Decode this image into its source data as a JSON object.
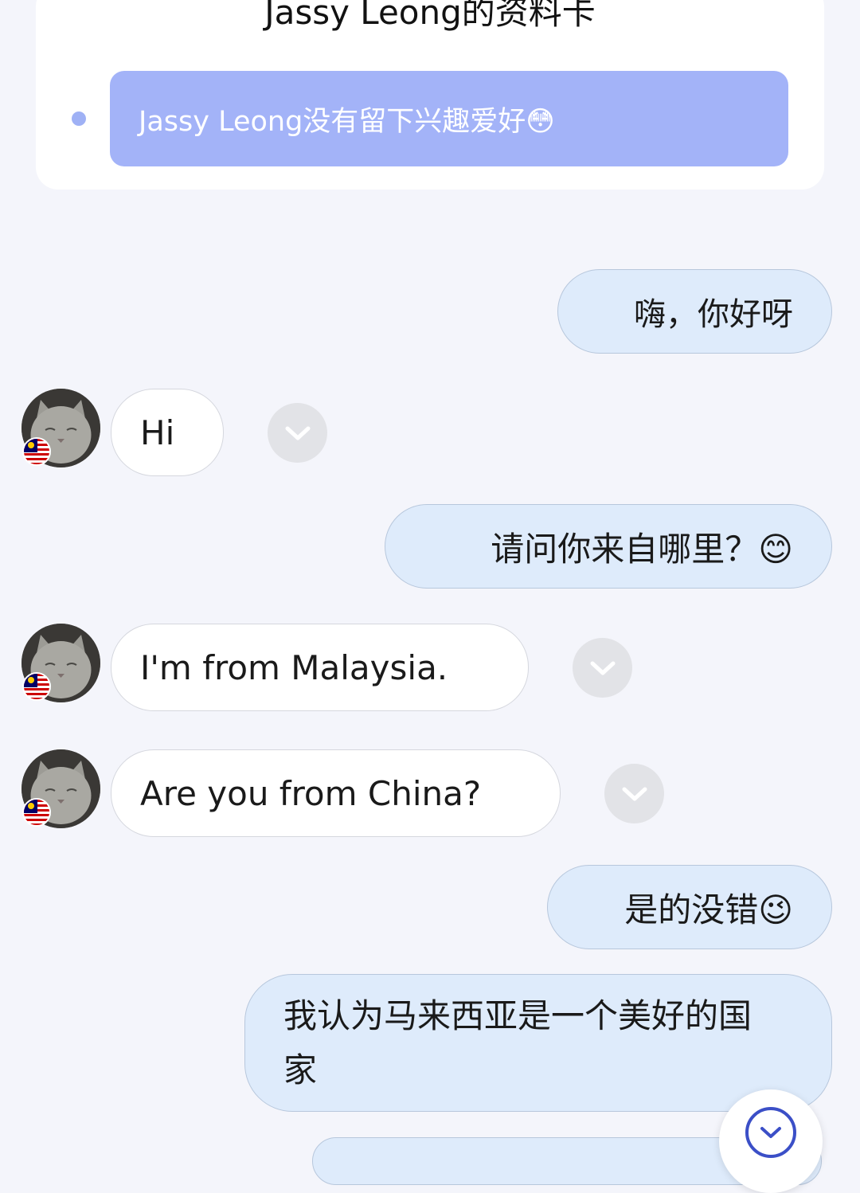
{
  "profile_card": {
    "title": "Jassy Leong的资料卡",
    "hobby_text": "Jassy Leong没有留下兴趣爱好😳"
  },
  "messages": [
    {
      "side": "mine",
      "text": "嗨，你好呀"
    },
    {
      "side": "theirs",
      "text": "Hi"
    },
    {
      "side": "mine",
      "text": "请问你来自哪里？😊"
    },
    {
      "side": "theirs",
      "text": "I'm from Malaysia."
    },
    {
      "side": "theirs",
      "text": "Are you from China?"
    },
    {
      "side": "mine",
      "text": "是的没错😉"
    },
    {
      "side": "mine",
      "text": "我认为马来西亚是一个美好的国家"
    }
  ],
  "contact": {
    "avatar_icon": "cat-avatar-icon",
    "flag_icon": "malaysia-flag-icon"
  },
  "icons": {
    "translate": "chevron-down-icon",
    "scroll_down": "scroll-down-icon"
  },
  "colors": {
    "page_bg": "#f4f5fb",
    "card_bg": "#ffffff",
    "hobby_pill": "#a3b3f8",
    "my_bubble": "#deebfb",
    "their_bubble": "#ffffff",
    "accent": "#3b4fc7"
  }
}
